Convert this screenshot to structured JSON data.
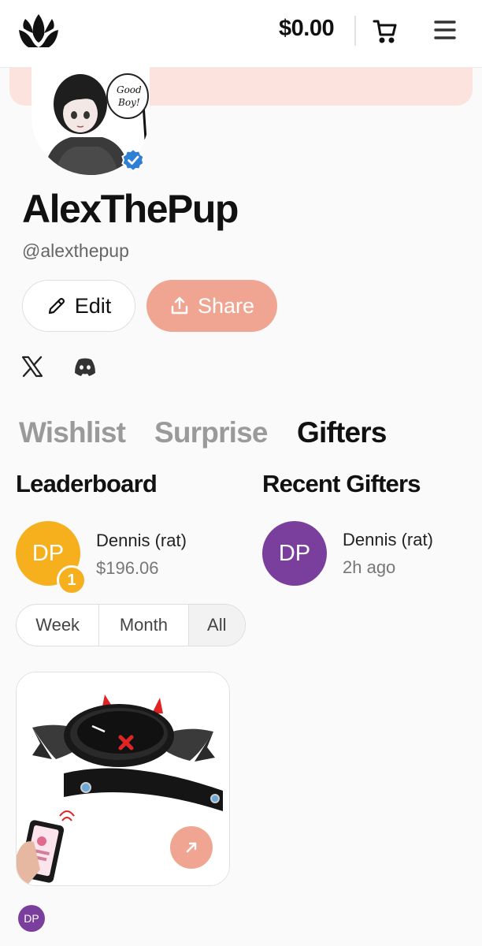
{
  "header": {
    "balance": "$0.00",
    "logo_icon": "crown-logo-icon",
    "cart_icon": "cart-icon",
    "menu_icon": "hamburger-menu-icon"
  },
  "profile": {
    "display_name": "AlexThePup",
    "handle": "@alexthepup",
    "avatar_speech_bubble": [
      "Good",
      "Boy!"
    ],
    "verified_icon": "verified-check-icon",
    "banner_color": "#fde3de"
  },
  "actions": {
    "edit_label": "Edit",
    "share_label": "Share",
    "accent_color": "#f0a592"
  },
  "socials": [
    "x-icon",
    "discord-icon"
  ],
  "tabs": [
    {
      "label": "Wishlist",
      "active": false
    },
    {
      "label": "Surprise",
      "active": false
    },
    {
      "label": "Gifters",
      "active": true
    }
  ],
  "leaderboard": {
    "title": "Leaderboard",
    "entries": [
      {
        "initials": "DP",
        "name": "Dennis (rat)",
        "amount": "$196.06",
        "rank": "1",
        "color": "#f6b01e"
      }
    ],
    "periods": [
      "Week",
      "Month",
      "All"
    ],
    "selected_period": "All"
  },
  "recent_gifters": {
    "title": "Recent Gifters",
    "entries": [
      {
        "initials": "DP",
        "name": "Dennis (rat)",
        "time": "2h ago",
        "color": "#7a3f9d"
      }
    ]
  },
  "gift_card": {
    "open_icon": "arrow-up-right-icon",
    "gifter_initials": "DP"
  }
}
